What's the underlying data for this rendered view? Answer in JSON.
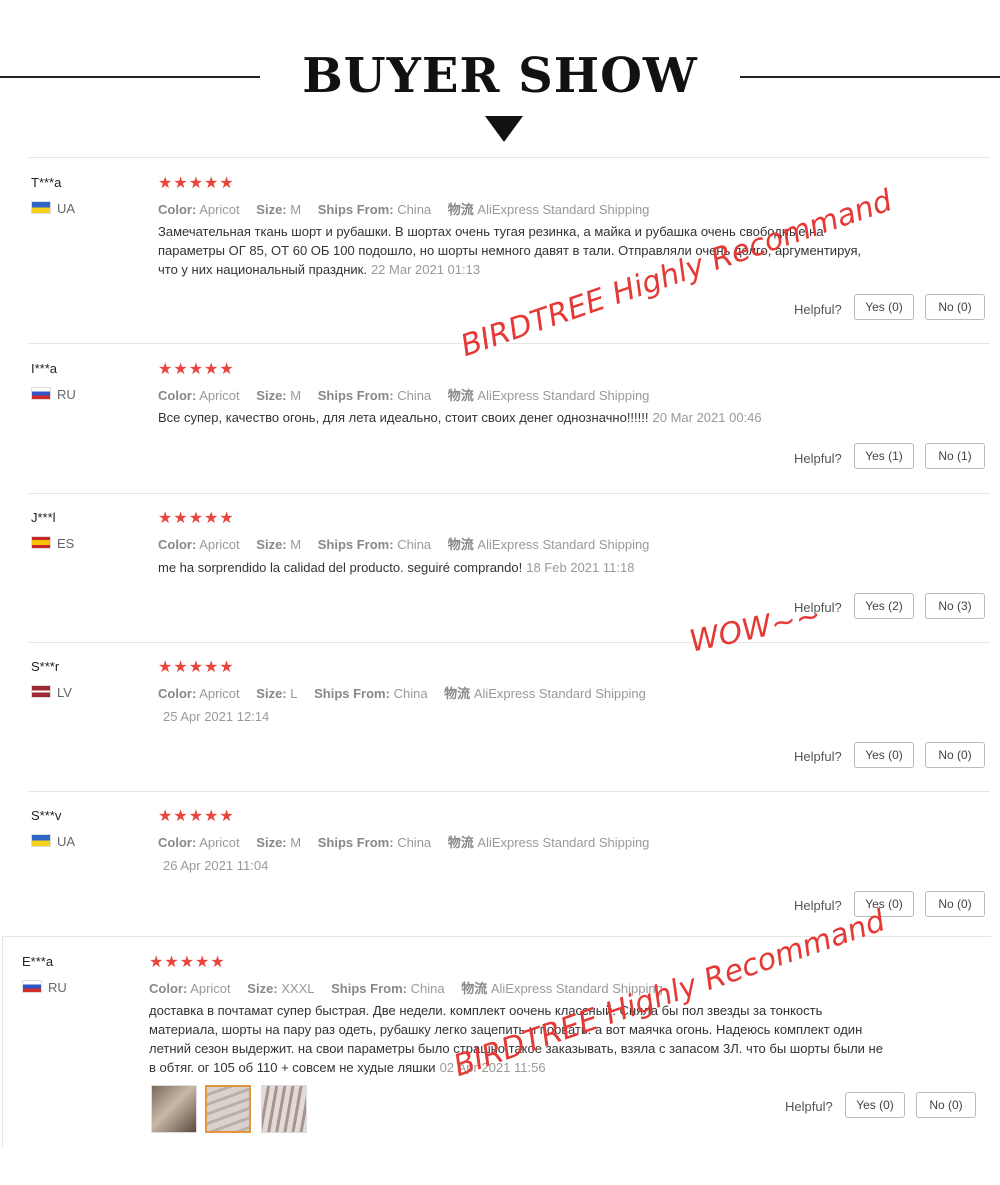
{
  "header": {
    "title": "BUYER SHOW"
  },
  "labels": {
    "color": "Color:",
    "size": "Size:",
    "ships": "Ships From:",
    "logistics": "物流",
    "helpful": "Helpful?"
  },
  "reviews": [
    {
      "user": "T***a",
      "country": "UA",
      "stars": "★★★★★",
      "color": "Apricot",
      "size": "M",
      "ships": "China",
      "shipping": "AliExpress Standard Shipping",
      "text": "Замечательная ткань шорт и рубашки. В шортах очень тугая резинка, а майка и рубашка очень свободные на параметры ОГ 85, ОТ 60 ОБ 100 подошло, но шорты немного давят в тали. Отправляли очень долго, аргументируя, что у них национальный праздник.",
      "date": "22 Mar 2021 01:13",
      "yes": "Yes (0)",
      "no": "No (0)"
    },
    {
      "user": "I***a",
      "country": "RU",
      "stars": "★★★★★",
      "color": "Apricot",
      "size": "M",
      "ships": "China",
      "shipping": "AliExpress Standard Shipping",
      "text": "Все супер, качество огонь, для лета идеально, стоит своих денег однозначно!!!!!!",
      "date": "20 Mar 2021 00:46",
      "yes": "Yes (1)",
      "no": "No (1)"
    },
    {
      "user": "J***l",
      "country": "ES",
      "stars": "★★★★★",
      "color": "Apricot",
      "size": "M",
      "ships": "China",
      "shipping": "AliExpress Standard Shipping",
      "text": "me ha sorprendido la calidad del producto. seguiré comprando!",
      "date": "18 Feb 2021 11:18",
      "yes": "Yes (2)",
      "no": "No (3)"
    },
    {
      "user": "S***r",
      "country": "LV",
      "stars": "★★★★★",
      "color": "Apricot",
      "size": "L",
      "ships": "China",
      "shipping": "AliExpress Standard Shipping",
      "text": "",
      "date": "25 Apr 2021 12:14",
      "yes": "Yes (0)",
      "no": "No (0)"
    },
    {
      "user": "S***v",
      "country": "UA",
      "stars": "★★★★★",
      "color": "Apricot",
      "size": "M",
      "ships": "China",
      "shipping": "AliExpress Standard Shipping",
      "text": "",
      "date": "26 Apr 2021 11:04",
      "yes": "Yes (0)",
      "no": "No (0)"
    },
    {
      "user": "E***a",
      "country": "RU",
      "stars": "★★★★★",
      "color": "Apricot",
      "size": "XXXL",
      "ships": "China",
      "shipping": "AliExpress Standard Shipping",
      "text": "доставка в почтамат супер быстрая. Две недели. комплект оочень классный. Сняла бы пол звезды за тонкость материала, шорты на пару раз одеть, рубашку легко зацепить и порвать. а вот маячка огонь. Надеюсь комплект один летний сезон выдержит. на свои параметры было страшно такое заказывать, взяла с запасом 3Л. что бы шорты были не в обтяг. ог 105 об 110 + совсем не худые ляшки",
      "date": "02 Apr 2021 11:56",
      "yes": "Yes (0)",
      "no": "No (0)"
    }
  ],
  "stamps": {
    "recommend_1": "BIRDTREE  Highly  Recommand",
    "wow": "WOW~~",
    "recommend_2": "BIRDTREE  Highly  Recommand"
  },
  "colors": {
    "star": "#e8453c",
    "stamp": "#e53935"
  }
}
